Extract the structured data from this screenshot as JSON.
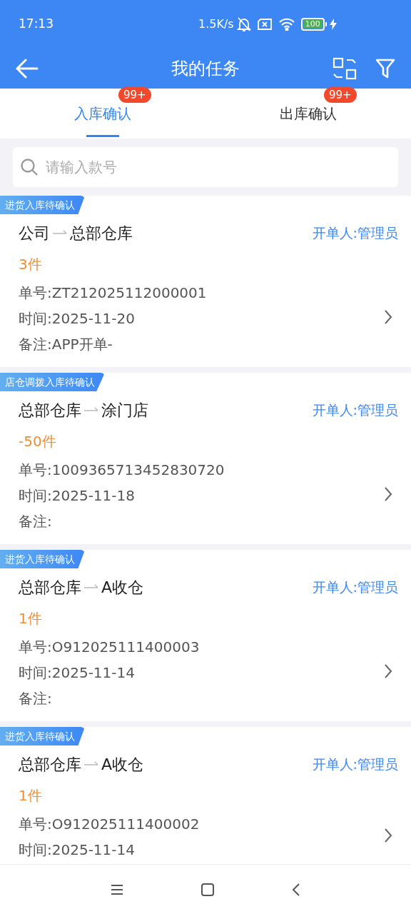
{
  "status_bar": {
    "time": "17:13",
    "speed": "1.5K/s",
    "battery": "100"
  },
  "header": {
    "title": "我的任务"
  },
  "tabs": [
    {
      "label": "入库确认",
      "badge": "99+",
      "selected": true
    },
    {
      "label": "出库确认",
      "badge": "99+",
      "selected": false
    }
  ],
  "search": {
    "placeholder": "请输入款号"
  },
  "orders": [
    {
      "tag": "进货入库待确认",
      "from": "公司",
      "to": "总部仓库",
      "creator": "开单人:管理员",
      "quantity": "3件",
      "number": "单号:ZT212025112000001",
      "time": "时间:2025-11-20",
      "remark": "备注:APP开单-"
    },
    {
      "tag": "店仓调拨入库待确认",
      "from": "总部仓库",
      "to": "涂门店",
      "creator": "开单人:管理员",
      "quantity": "-50件",
      "number": "单号:1009365713452830720",
      "time": "时间:2025-11-18",
      "remark": "备注:"
    },
    {
      "tag": "进货入库待确认",
      "from": "总部仓库",
      "to": "A收仓",
      "creator": "开单人:管理员",
      "quantity": "1件",
      "number": "单号:O912025111400003",
      "time": "时间:2025-11-14",
      "remark": "备注:"
    },
    {
      "tag": "进货入库待确认",
      "from": "总部仓库",
      "to": "A收仓",
      "creator": "开单人:管理员",
      "quantity": "1件",
      "number": "单号:O912025111400002",
      "time": "时间:2025-11-14"
    }
  ]
}
